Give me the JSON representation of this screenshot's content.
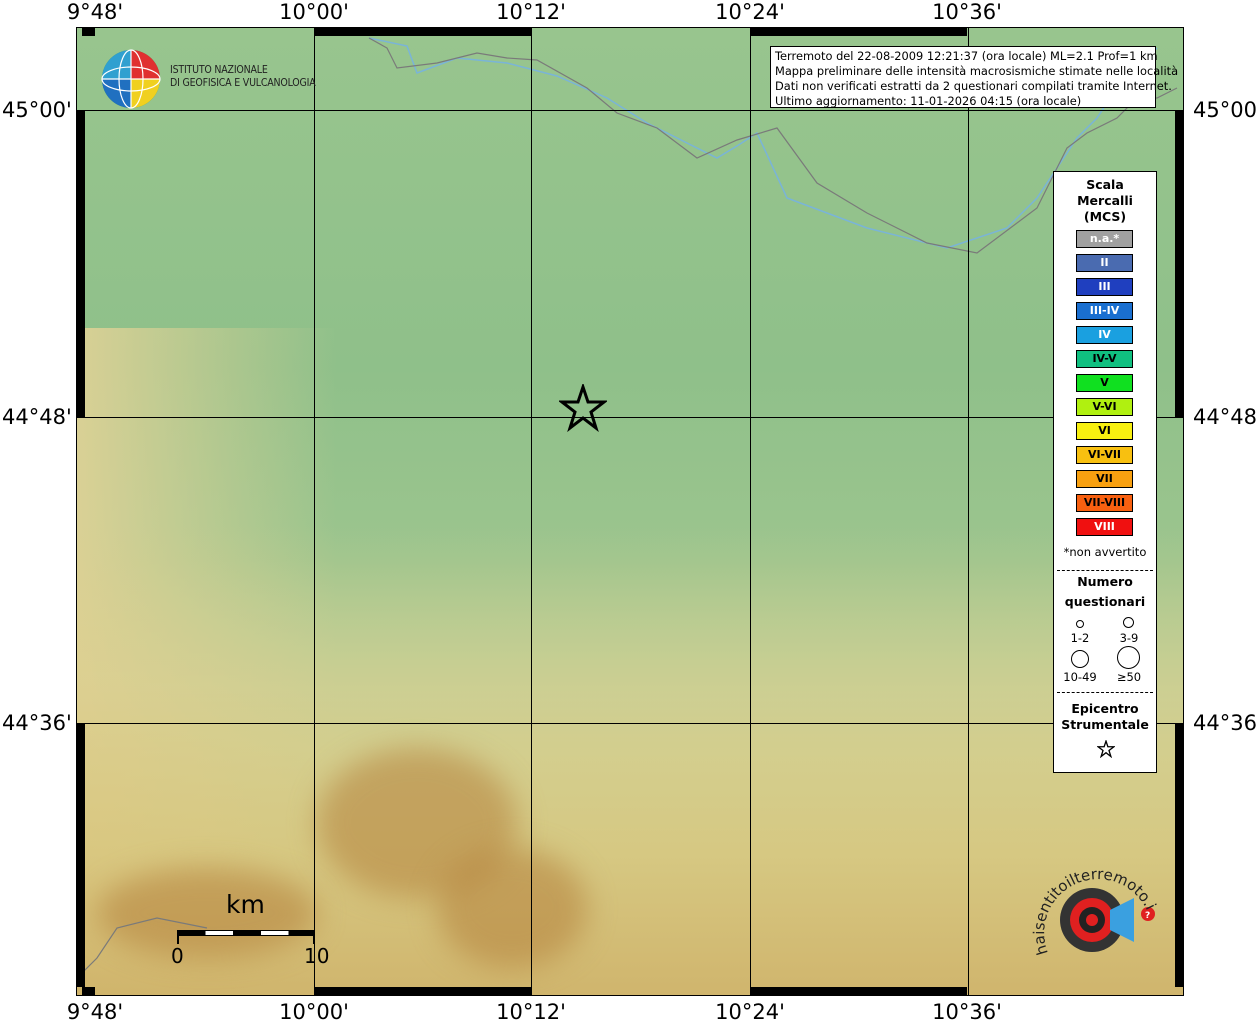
{
  "map": {
    "longitude_labels": [
      "9°48'",
      "10°00'",
      "10°12'",
      "10°24'",
      "10°36'"
    ],
    "latitude_labels": [
      "45°00'",
      "44°48'",
      "44°36'"
    ]
  },
  "info": {
    "line1": "Terremoto del 22-08-2009 12:21:37 (ora locale) ML=2.1 Prof=1 km",
    "line2": "Mappa preliminare delle intensità macrosismiche stimate nelle località",
    "line3": "Dati non verificati estratti da 2 questionari compilati tramite Internet.",
    "line4": "Ultimo aggiornamento: 11-01-2026 04:15 (ora locale)"
  },
  "logo": {
    "line1": "ISTITUTO NAZIONALE",
    "line2": "DI GEOFISICA E VULCANOLOGIA"
  },
  "legend": {
    "title_line1": "Scala",
    "title_line2": "Mercalli",
    "title_line3": "(MCS)",
    "levels": [
      {
        "label": "n.a.*",
        "color": "#a0a0a0",
        "text_color": "#ffffff"
      },
      {
        "label": "II",
        "color": "#4a6bb0",
        "text_color": "#ffffff"
      },
      {
        "label": "III",
        "color": "#1f3fbf",
        "text_color": "#ffffff"
      },
      {
        "label": "III-IV",
        "color": "#1a6fd0",
        "text_color": "#ffffff"
      },
      {
        "label": "IV",
        "color": "#1aa0e0",
        "text_color": "#ffffff"
      },
      {
        "label": "IV-V",
        "color": "#10c080",
        "text_color": "#000000"
      },
      {
        "label": "V",
        "color": "#10e020",
        "text_color": "#000000"
      },
      {
        "label": "V-VI",
        "color": "#b0f010",
        "text_color": "#000000"
      },
      {
        "label": "VI",
        "color": "#f8f010",
        "text_color": "#000000"
      },
      {
        "label": "VI-VII",
        "color": "#f8c010",
        "text_color": "#000000"
      },
      {
        "label": "VII",
        "color": "#f8a010",
        "text_color": "#000000"
      },
      {
        "label": "VII-VIII",
        "color": "#f86010",
        "text_color": "#000000"
      },
      {
        "label": "VIII",
        "color": "#f01010",
        "text_color": "#ffffff"
      }
    ],
    "note": "*non avvertito",
    "count_title_line1": "Numero",
    "count_title_line2": "questionari",
    "count_classes": [
      "1-2",
      "3-9",
      "10-49",
      "≥50"
    ],
    "epicenter_line1": "Epicentro",
    "epicenter_line2": "Strumentale"
  },
  "scalebar": {
    "unit": "km",
    "start": "0",
    "end": "10"
  },
  "hsit_logo": {
    "text": "haisentitoilterremoto.it",
    "url": "www."
  },
  "colors": {
    "plain_green": "#8fc08a",
    "hill_tan": "#e6dca6",
    "mountain_brown": "#c8a060",
    "river_blue": "#7ab4d8",
    "border_gray": "#7a7a7a"
  }
}
